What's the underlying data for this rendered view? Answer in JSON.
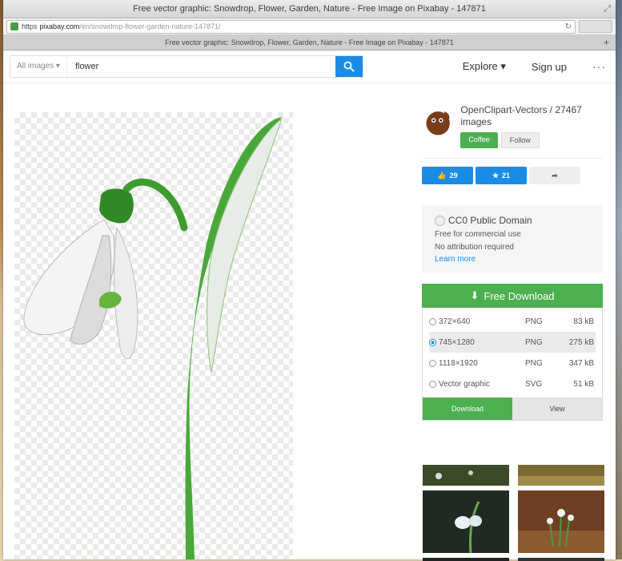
{
  "window": {
    "title": "Free vector graphic: Snowdrop, Flower, Garden, Nature - Free Image on Pixabay - 147871",
    "tab_title": "Free vector graphic: Snowdrop, Flower, Garden, Nature - Free Image on Pixabay - 147871"
  },
  "address": {
    "protocol": "https",
    "host": "pixabay.com",
    "path": "/en/snowdrop-flower-garden-nature-147871/"
  },
  "header": {
    "search_type": "All images ▾",
    "search_query": "flower",
    "nav": [
      "Explore ▾",
      "Sign up",
      "···"
    ]
  },
  "author": {
    "name": "OpenClipart-Vectors / 27467 images",
    "coffee_label": "Coffee",
    "follow_label": "Follow"
  },
  "stats": {
    "likes": "29",
    "favorites": "21"
  },
  "license": {
    "title": "CC0 Public Domain",
    "line1": "Free for commercial use",
    "line2": "No attribution required",
    "learn_more": "Learn more"
  },
  "download": {
    "label": "Free Download",
    "options": [
      {
        "res": "372×640",
        "format": "PNG",
        "size": "83 kB",
        "selected": false
      },
      {
        "res": "745×1280",
        "format": "PNG",
        "size": "275 kB",
        "selected": true
      },
      {
        "res": "1118×1920",
        "format": "PNG",
        "size": "347 kB",
        "selected": false
      },
      {
        "res": "Vector graphic",
        "format": "SVG",
        "size": "51 kB",
        "selected": false
      }
    ],
    "download_label": "Download",
    "view_label": "View"
  },
  "colors": {
    "accent_blue": "#1a8ce6",
    "accent_green": "#4caf50"
  }
}
